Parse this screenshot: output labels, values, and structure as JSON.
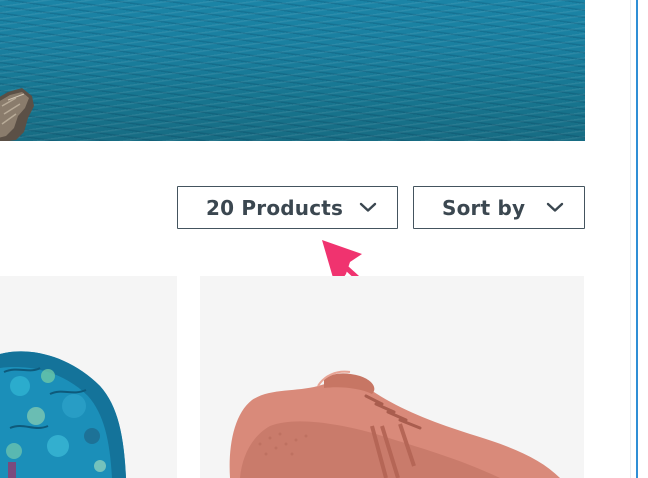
{
  "hero": {
    "image": "ocean-water-banner"
  },
  "toolbar": {
    "products_dropdown": {
      "label": "20 Products",
      "icon": "chevron-down-icon"
    },
    "sort_dropdown": {
      "label": "Sort by",
      "icon": "chevron-down-icon"
    }
  },
  "annotation": {
    "icon": "arrow-pointer-icon",
    "color": "#f0336f"
  },
  "products": [
    {
      "image": "patterned-backpack-image",
      "color": "#1b8fb9"
    },
    {
      "image": "pink-sneaker-image",
      "color": "#d98a7a"
    }
  ],
  "colors": {
    "accent_blue": "#2f8fd6",
    "control_border": "#44545e",
    "text": "#3b4750",
    "card_bg": "#f5f5f5"
  }
}
